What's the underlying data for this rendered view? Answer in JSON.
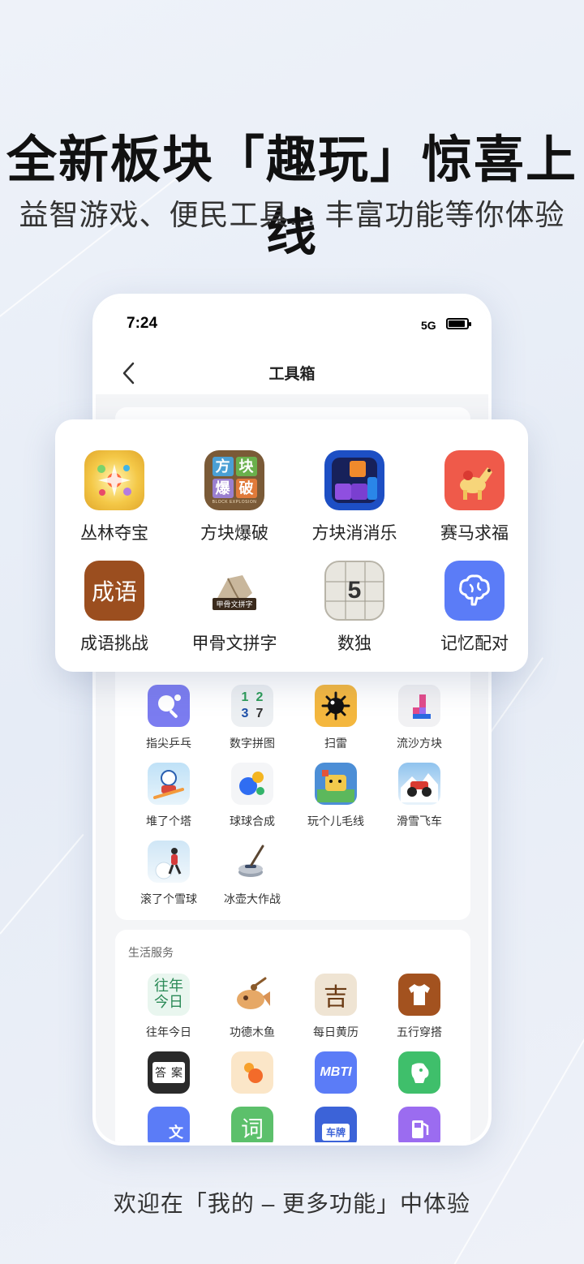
{
  "promo": {
    "headline": "全新板块「趣玩」惊喜上线",
    "subline": "益智游戏、便民工具... 丰富功能等你体验",
    "footer": "欢迎在「我的 – 更多功能」中体验"
  },
  "status_bar": {
    "time": "7:24",
    "network": "5G"
  },
  "nav": {
    "title": "工具箱"
  },
  "featured_games": [
    {
      "label": "丛林夺宝",
      "icon": "jungle-treasure-icon"
    },
    {
      "label": "方块爆破",
      "icon": "block-explosion-icon",
      "icon_text": [
        "方",
        "块",
        "爆",
        "破"
      ],
      "icon_sub": "BLOCK EXPLOSION"
    },
    {
      "label": "方块消消乐",
      "icon": "block-match-icon"
    },
    {
      "label": "赛马求福",
      "icon": "horse-race-icon"
    },
    {
      "label": "成语挑战",
      "icon": "idiom-challenge-icon",
      "icon_text": "成语"
    },
    {
      "label": "甲骨文拼字",
      "icon": "oracle-bone-icon",
      "icon_text": "甲骨文拼字"
    },
    {
      "label": "数独",
      "icon": "sudoku-icon",
      "icon_text": "5"
    },
    {
      "label": "记忆配对",
      "icon": "brain-memory-icon"
    }
  ],
  "more_games": [
    {
      "label": "指尖乒乓",
      "icon": "ping-pong-icon"
    },
    {
      "label": "数字拼图",
      "icon": "number-puzzle-icon",
      "icon_text": [
        "1",
        "2",
        "3",
        "7"
      ]
    },
    {
      "label": "扫雷",
      "icon": "minesweeper-icon"
    },
    {
      "label": "流沙方块",
      "icon": "sand-blocks-icon"
    },
    {
      "label": "堆了个塔",
      "icon": "tower-stack-icon"
    },
    {
      "label": "球球合成",
      "icon": "ball-merge-icon"
    },
    {
      "label": "玩个儿毛线",
      "icon": "yarn-icon"
    },
    {
      "label": "滑雪飞车",
      "icon": "snow-racer-icon"
    },
    {
      "label": "滚了个雪球",
      "icon": "snowball-icon"
    },
    {
      "label": "冰壶大作战",
      "icon": "curling-icon"
    }
  ],
  "life_services": {
    "title": "生活服务",
    "items": [
      {
        "label": "往年今日",
        "icon": "this-day-icon",
        "icon_text": [
          "往年",
          "今日"
        ]
      },
      {
        "label": "功德木鱼",
        "icon": "wooden-fish-icon"
      },
      {
        "label": "每日黄历",
        "icon": "almanac-icon",
        "icon_text": "吉"
      },
      {
        "label": "五行穿搭",
        "icon": "outfit-icon"
      }
    ],
    "unlabeled_icons": [
      {
        "icon": "answer-book-icon",
        "icon_text": [
          "答",
          "案"
        ]
      },
      {
        "icon": "color-dots-icon"
      },
      {
        "icon": "mbti-icon",
        "icon_text": "MBTI"
      },
      {
        "icon": "pet-icon"
      },
      {
        "icon": "translate-icon",
        "icon_text": "文"
      },
      {
        "icon": "word-icon",
        "icon_text": "词"
      },
      {
        "icon": "license-plate-icon",
        "icon_text": "车牌"
      },
      {
        "icon": "fuel-icon"
      }
    ]
  },
  "colors": {
    "accent_blue": "#5b7cf7",
    "brown": "#9b4e1f",
    "purple": "#9b6cf0",
    "green": "#3fbf6b"
  }
}
